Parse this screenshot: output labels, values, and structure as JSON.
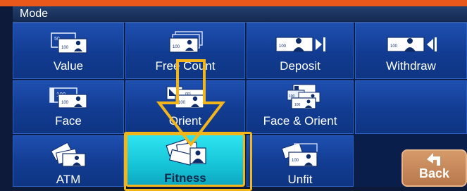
{
  "header": {
    "title": "Mode"
  },
  "tiles": [
    {
      "label": "Value",
      "icon": "note-value-icon"
    },
    {
      "label": "Free Count",
      "icon": "note-stack-icon"
    },
    {
      "label": "Deposit",
      "icon": "deposit-icon"
    },
    {
      "label": "Withdraw",
      "icon": "withdraw-icon"
    },
    {
      "label": "Face",
      "icon": "note-face-icon"
    },
    {
      "label": "Orient",
      "icon": "note-orient-icon"
    },
    {
      "label": "Face & Orient",
      "icon": "face-orient-icon"
    },
    {
      "label": "",
      "icon": ""
    },
    {
      "label": "ATM",
      "icon": "atm-icon"
    },
    {
      "label": "Fitness",
      "icon": "fitness-icon"
    },
    {
      "label": "Unfit",
      "icon": "unfit-icon"
    }
  ],
  "selected_mode": "Fitness",
  "back_button": {
    "label": "Back",
    "icon": "return-arrow-icon"
  },
  "colors": {
    "accent_orange": "#e8581a",
    "highlight_yellow": "#f2b51a",
    "tile_blue": "#123c92",
    "selected_cyan": "#16c4d8"
  }
}
